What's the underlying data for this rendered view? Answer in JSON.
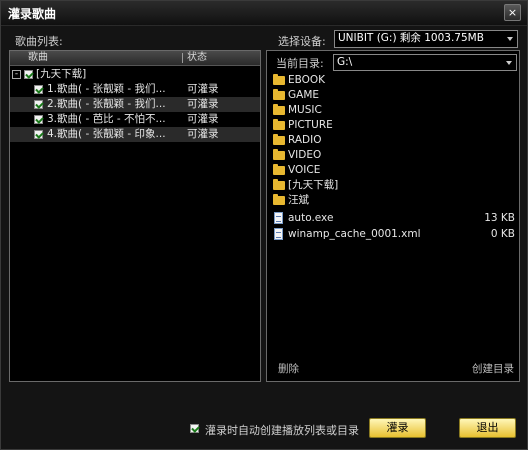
{
  "window": {
    "title": "灌录歌曲",
    "close_label": "×"
  },
  "left": {
    "title": "歌曲列表:",
    "columns": [
      "歌曲",
      "状态"
    ],
    "group": {
      "label": "[九天下载]"
    },
    "songs": [
      {
        "name": "1.歌曲( - 张靓颖 - 我们...",
        "status": "可灌录",
        "checked": true
      },
      {
        "name": "2.歌曲( - 张靓颖 - 我们...",
        "status": "可灌录",
        "checked": true
      },
      {
        "name": "3.歌曲( - 芭比 - 不怕不...",
        "status": "可灌录",
        "checked": true
      },
      {
        "name": "4.歌曲( - 张靓颖 - 印象...",
        "status": "可灌录",
        "checked": true
      }
    ]
  },
  "right": {
    "device_label": "选择设备:",
    "device_value": "UNIBIT (G:) 剩余 1003.75MB",
    "dir_label": "当前目录:",
    "dir_value": "G:\\",
    "entries": [
      {
        "type": "folder",
        "name": "EBOOK",
        "size": ""
      },
      {
        "type": "folder",
        "name": "GAME",
        "size": ""
      },
      {
        "type": "folder",
        "name": "MUSIC",
        "size": ""
      },
      {
        "type": "folder",
        "name": "PICTURE",
        "size": ""
      },
      {
        "type": "folder",
        "name": "RADIO",
        "size": ""
      },
      {
        "type": "folder",
        "name": "VIDEO",
        "size": ""
      },
      {
        "type": "folder",
        "name": "VOICE",
        "size": ""
      },
      {
        "type": "folder",
        "name": "[九天下载]",
        "size": ""
      },
      {
        "type": "folder",
        "name": "汪斌",
        "size": ""
      },
      {
        "type": "file",
        "name": "auto.exe",
        "size": "13 KB"
      },
      {
        "type": "file",
        "name": "winamp_cache_0001.xml",
        "size": "0 KB"
      }
    ],
    "delete_label": "删除",
    "create_dir_label": "创建目录"
  },
  "footer": {
    "auto_create_label": "灌录时自动创建播放列表或目录",
    "auto_create_checked": true,
    "burn_label": "灌录",
    "exit_label": "退出"
  },
  "colors": {
    "button_gradient_top": "#fff7b8",
    "button_gradient_bottom": "#e8c030",
    "folder": "#e8b830"
  }
}
